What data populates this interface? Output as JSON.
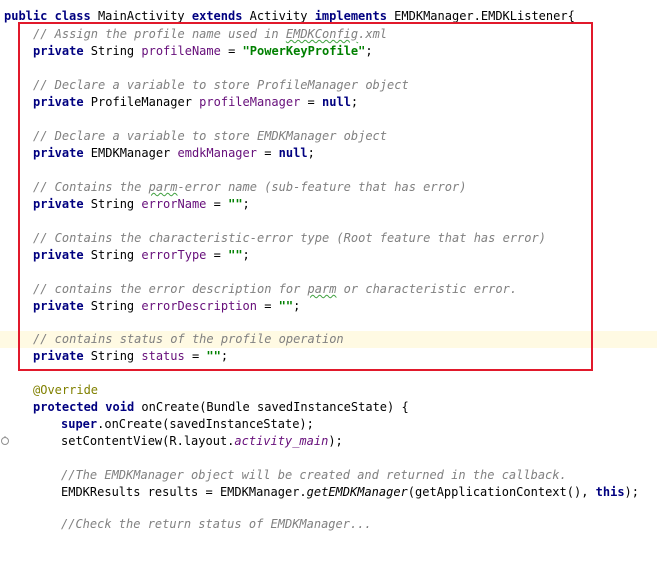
{
  "code": {
    "class_header": {
      "kw_public": "public",
      "kw_class": "class",
      "class_name": " MainActivity ",
      "kw_extends": "extends",
      "super_class": " Activity ",
      "kw_implements": "implements",
      "interface_name": " EMDKManager.EMDKListener{"
    },
    "comment_profile_a": "// Assign the profile name used in ",
    "comment_profile_spell": "EMDKConfig",
    "comment_profile_b": ".xml",
    "kw_private": "private",
    "type_string": " String ",
    "field_profile_name": "profileName",
    "profile_name_value": "\"PowerKeyProfile\"",
    "comment_profile_manager": "// Declare a variable to store ProfileManager object",
    "type_profile_manager": " ProfileManager ",
    "field_profile_manager": "profileManager",
    "kw_null": "null",
    "comment_emdk_manager": "// Declare a variable to store EMDKManager object",
    "type_emdk_manager": " EMDKManager ",
    "field_emdk_manager": "emdkManager",
    "comment_parm_error_a": "// Contains the ",
    "comment_parm_error_spell": "parm",
    "comment_parm_error_b": "-error name (sub-feature that has error)",
    "field_error_name": "errorName",
    "empty_string": "\"\"",
    "comment_char_error": "// Contains the characteristic-error type (Root feature that has error)",
    "field_error_type": "errorType",
    "comment_error_desc_a": "// contains the error description for ",
    "comment_error_desc_spell": "parm",
    "comment_error_desc_b": " or characteristic error.",
    "field_error_description": "errorDescription",
    "comment_status": "// contains status of the profile operation",
    "field_status": "status",
    "annotation_override": "@Override",
    "kw_protected": "protected",
    "kw_void": "void",
    "method_on_create_sig": " onCreate(Bundle savedInstanceState) {",
    "kw_super": "super",
    "super_call": ".onCreate(savedInstanceState);",
    "set_content_view_a": "setContentView(R.layout.",
    "field_activity_main": "activity_main",
    "set_content_view_b": ");",
    "comment_emdk_callback": "//The EMDKManager object will be created and returned in the callback.",
    "results_decl": "EMDKResults results = EMDKManager.",
    "method_get_emdk_manager": "getEMDKManager",
    "results_args": "(getApplicationContext(), ",
    "kw_this": "this",
    "results_end": ");",
    "equals": " = ",
    "semicolon": ";",
    "truncated_line": "//Check the return status of EMDKManager..."
  },
  "colors": {
    "keyword": "#000080",
    "comment": "#808080",
    "string": "#008000",
    "field": "#660e7a",
    "annotation": "#808000",
    "current_line": "#fffae3",
    "selection_box": "#e1192b"
  },
  "icons": [
    "override-method-icon"
  ]
}
